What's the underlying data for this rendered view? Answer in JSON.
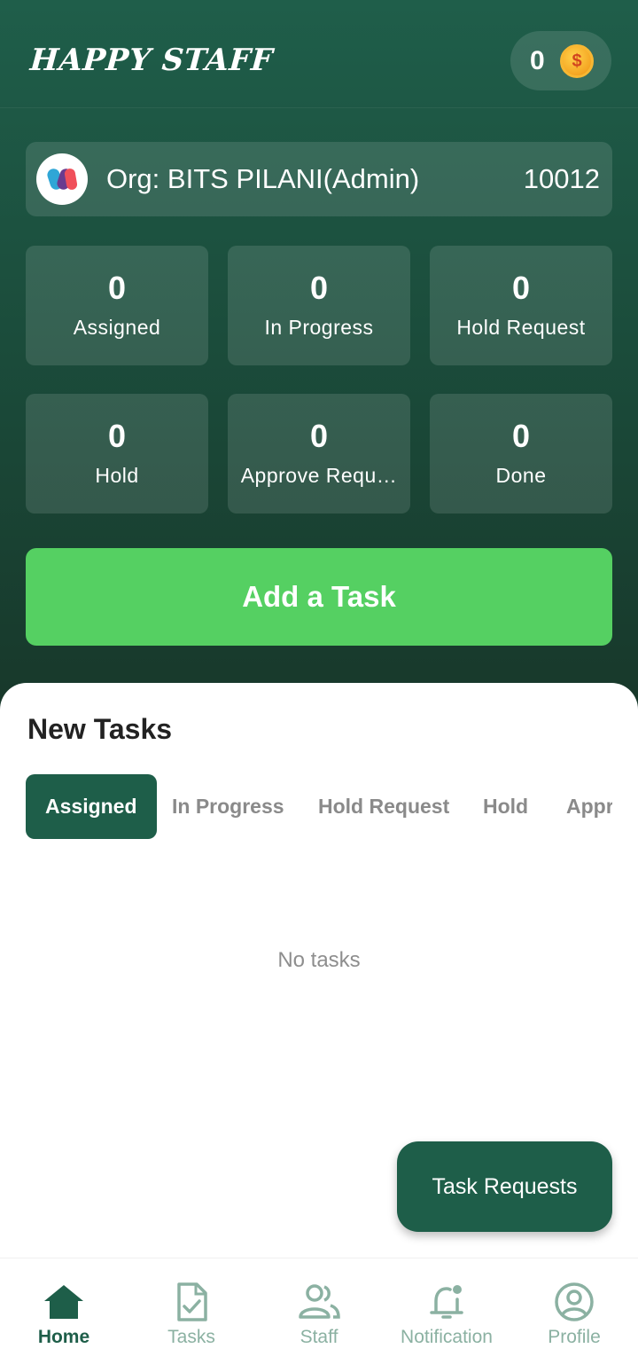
{
  "header": {
    "brand": "HAPPY STAFF",
    "coins": "0",
    "coin_symbol": "$"
  },
  "org": {
    "label": "Org: BITS PILANI(Admin)",
    "id": "10012"
  },
  "stats": [
    {
      "value": "0",
      "label": "Assigned"
    },
    {
      "value": "0",
      "label": "In Progress"
    },
    {
      "value": "0",
      "label": "Hold Request"
    },
    {
      "value": "0",
      "label": "Hold"
    },
    {
      "value": "0",
      "label": "Approve Requ…"
    },
    {
      "value": "0",
      "label": "Done"
    }
  ],
  "add_task_label": "Add a Task",
  "new_tasks": {
    "title": "New Tasks",
    "tabs": [
      "Assigned",
      "In Progress",
      "Hold Request",
      "Hold",
      "Appr"
    ],
    "empty_text": "No tasks"
  },
  "fab_label": "Task Requests",
  "nav": [
    {
      "label": "Home",
      "icon": "home-icon",
      "active": true
    },
    {
      "label": "Tasks",
      "icon": "task-document-icon",
      "active": false
    },
    {
      "label": "Staff",
      "icon": "staff-people-icon",
      "active": false
    },
    {
      "label": "Notification",
      "icon": "bell-icon",
      "active": false
    },
    {
      "label": "Profile",
      "icon": "profile-icon",
      "active": false
    }
  ],
  "colors": {
    "primary": "#1e5e49",
    "accent_green": "#55d062",
    "nav_inactive": "#8bb1a2"
  }
}
